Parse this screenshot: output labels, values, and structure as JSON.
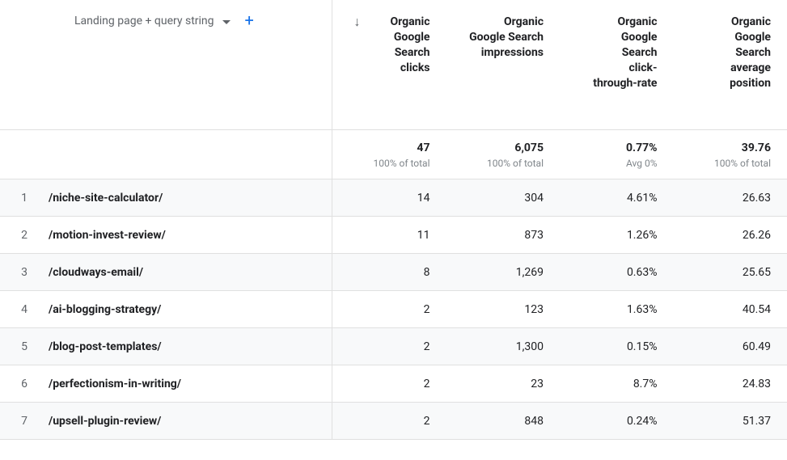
{
  "dimension": {
    "label": "Landing page + query string"
  },
  "columns": [
    {
      "label": "Organic Google Search clicks",
      "total": "47",
      "sub": "100% of total",
      "sorted": true
    },
    {
      "label": "Organic Google Search impressions",
      "total": "6,075",
      "sub": "100% of total",
      "sorted": false
    },
    {
      "label": "Organic Google Search click-through-rate",
      "total": "0.77%",
      "sub": "Avg 0%",
      "sorted": false
    },
    {
      "label": "Organic Google Search average position",
      "total": "39.76",
      "sub": "100% of total",
      "sorted": false
    }
  ],
  "rows": [
    {
      "idx": "1",
      "page": "/niche-site-calculator/",
      "cells": [
        "14",
        "304",
        "4.61%",
        "26.63"
      ]
    },
    {
      "idx": "2",
      "page": "/motion-invest-review/",
      "cells": [
        "11",
        "873",
        "1.26%",
        "26.26"
      ]
    },
    {
      "idx": "3",
      "page": "/cloudways-email/",
      "cells": [
        "8",
        "1,269",
        "0.63%",
        "25.65"
      ]
    },
    {
      "idx": "4",
      "page": "/ai-blogging-strategy/",
      "cells": [
        "2",
        "123",
        "1.63%",
        "40.54"
      ]
    },
    {
      "idx": "5",
      "page": "/blog-post-templates/",
      "cells": [
        "2",
        "1,300",
        "0.15%",
        "60.49"
      ]
    },
    {
      "idx": "6",
      "page": "/perfectionism-in-writing/",
      "cells": [
        "2",
        "23",
        "8.7%",
        "24.83"
      ]
    },
    {
      "idx": "7",
      "page": "/upsell-plugin-review/",
      "cells": [
        "2",
        "848",
        "0.24%",
        "51.37"
      ]
    }
  ]
}
